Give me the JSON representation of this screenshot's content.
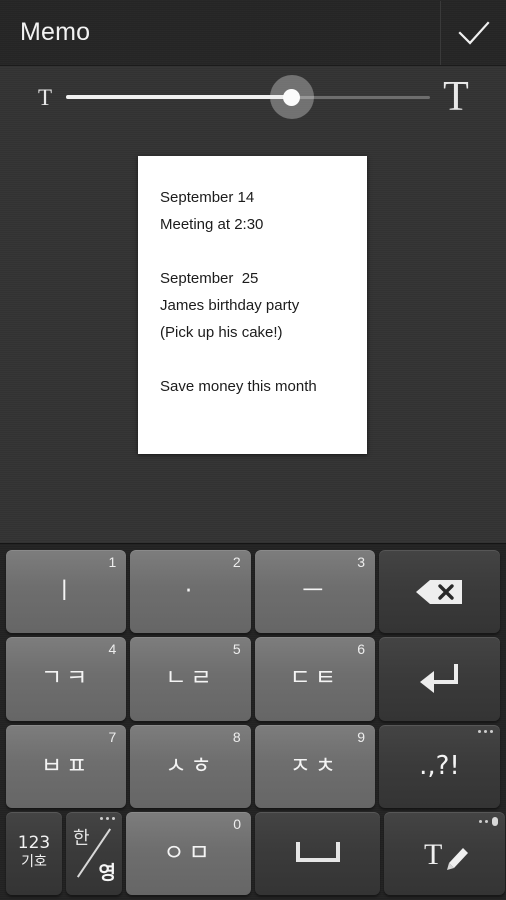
{
  "header": {
    "title": "Memo",
    "done_icon": "check-icon"
  },
  "font_slider": {
    "small_label": "T",
    "large_label": "T",
    "value_percent": 62,
    "min_label": "T",
    "max_label": "T"
  },
  "memo": {
    "lines": [
      "September 14",
      "Meeting at 2:30",
      "",
      "September  25",
      "James birthday party",
      "(Pick up his cake!)",
      "",
      "Save money this month"
    ],
    "paper_color": "#ffffff",
    "text_color": "#1c1c1c"
  },
  "keyboard": {
    "layout_name": "korean-cheonjiin",
    "rows": [
      {
        "keys": [
          {
            "name": "key-vertical-stroke",
            "main": "ㅣ",
            "num": "1",
            "style": "light"
          },
          {
            "name": "key-dot",
            "main": "·",
            "num": "2",
            "style": "light"
          },
          {
            "name": "key-horizontal-stroke",
            "main": "ㅡ",
            "num": "3",
            "style": "light"
          },
          {
            "name": "key-backspace",
            "main": "",
            "num": "",
            "style": "dark",
            "icon": "backspace-icon"
          }
        ]
      },
      {
        "keys": [
          {
            "name": "key-giyeok-kieuk",
            "main": "ㄱㅋ",
            "num": "4",
            "style": "light"
          },
          {
            "name": "key-nieun-rieul",
            "main": "ㄴㄹ",
            "num": "5",
            "style": "light"
          },
          {
            "name": "key-digeut-tieut",
            "main": "ㄷㅌ",
            "num": "6",
            "style": "light"
          },
          {
            "name": "key-enter",
            "main": "",
            "num": "",
            "style": "dark",
            "icon": "enter-icon"
          }
        ]
      },
      {
        "keys": [
          {
            "name": "key-bieup-pieup",
            "main": "ㅂㅍ",
            "num": "7",
            "style": "light"
          },
          {
            "name": "key-siot-hieut",
            "main": "ㅅㅎ",
            "num": "8",
            "style": "light"
          },
          {
            "name": "key-jieut-chieut",
            "main": "ㅈㅊ",
            "num": "9",
            "style": "light"
          },
          {
            "name": "key-punctuation",
            "main": ".,?!",
            "num": "",
            "style": "dark",
            "dots": 3
          }
        ]
      },
      {
        "keys": [
          {
            "name": "key-numbers-symbols",
            "main": "123",
            "sub": "기호",
            "num": "",
            "style": "dark"
          },
          {
            "name": "key-language-toggle",
            "main": "한",
            "sub": "영",
            "num": "",
            "style": "dark",
            "dots": 3
          },
          {
            "name": "key-ieung-mieum",
            "main": "ㅇㅁ",
            "num": "0",
            "style": "light"
          },
          {
            "name": "key-space",
            "main": "",
            "num": "",
            "style": "dark",
            "icon": "space-icon"
          },
          {
            "name": "key-handwriting-voice",
            "main": "",
            "num": "",
            "style": "dark",
            "icon": "handwriting-icon",
            "dots": 2,
            "mic": true
          }
        ]
      }
    ]
  },
  "colors": {
    "background": "#333333",
    "titlebar": "#262626",
    "keyboard_bg": "#232323",
    "key_light": "#6e6e6e",
    "key_dark": "#3b3b3b",
    "text_light": "#f2f2f2"
  }
}
